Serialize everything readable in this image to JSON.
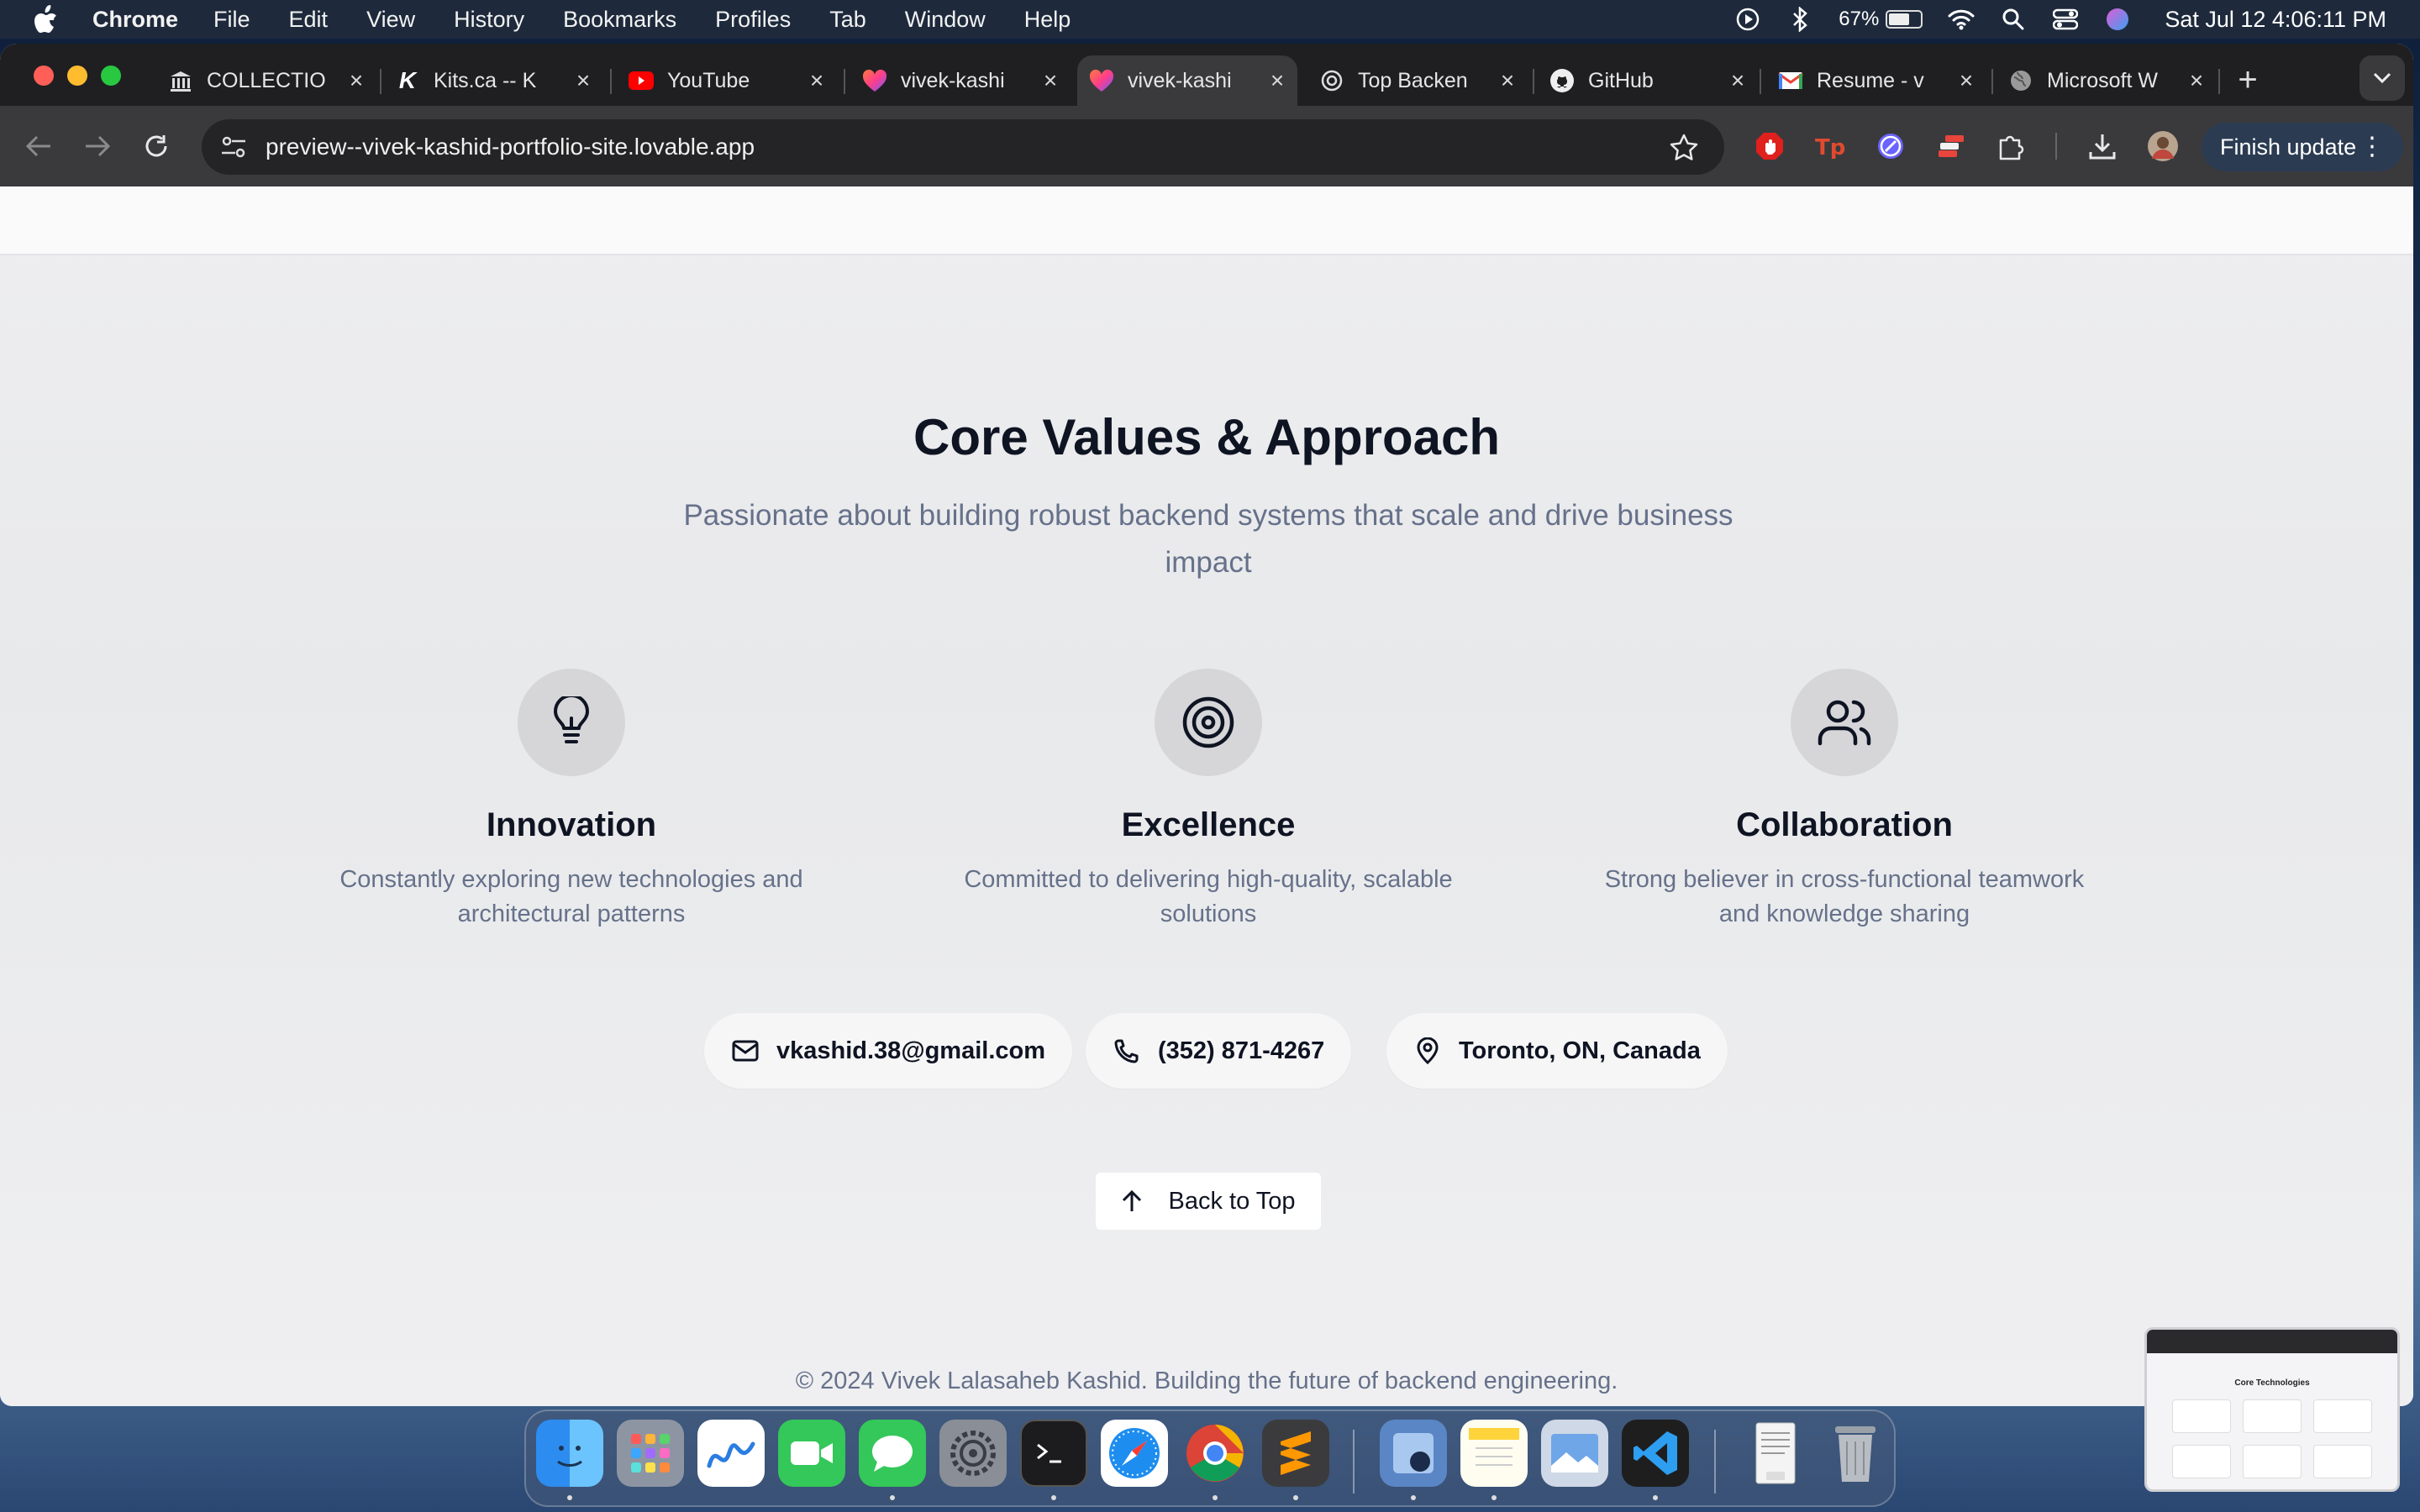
{
  "menubar": {
    "app_name": "Chrome",
    "items": [
      "File",
      "Edit",
      "View",
      "History",
      "Bookmarks",
      "Profiles",
      "Tab",
      "Window",
      "Help"
    ],
    "battery_percent": "67%",
    "battery_level": 0.67,
    "clock": "Sat Jul 12  4:06:11 PM"
  },
  "tabs": [
    {
      "title": "COLLECTIO",
      "icon": "museum-icon"
    },
    {
      "title": "Kits.ca -- K",
      "icon": "kits-logo-icon"
    },
    {
      "title": "YouTube",
      "icon": "youtube-icon"
    },
    {
      "title": "vivek-kashi",
      "icon": "lovable-heart-icon"
    },
    {
      "title": "vivek-kashi",
      "icon": "lovable-heart-icon",
      "active": true
    },
    {
      "title": "Top Backen",
      "icon": "openai-icon"
    },
    {
      "title": "GitHub",
      "icon": "github-icon"
    },
    {
      "title": "Resume - v",
      "icon": "gmail-icon"
    },
    {
      "title": "Microsoft W",
      "icon": "globe-icon"
    }
  ],
  "toolbar": {
    "url": "preview--vivek-kashid-portfolio-site.lovable.app",
    "finish_update": "Finish update"
  },
  "page": {
    "title": "Core Values & Approach",
    "subtitle": "Passionate about building robust backend systems that scale and drive business impact",
    "values": [
      {
        "title": "Innovation",
        "description": "Constantly exploring new technologies and architectural patterns",
        "icon": "lightbulb-icon"
      },
      {
        "title": "Excellence",
        "description": "Committed to delivering high-quality, scalable solutions",
        "icon": "target-icon"
      },
      {
        "title": "Collaboration",
        "description": "Strong believer in cross-functional teamwork and knowledge sharing",
        "icon": "users-icon"
      }
    ],
    "contacts": {
      "email": "vkashid.38@gmail.com",
      "phone": "(352) 871-4267",
      "location": "Toronto, ON, Canada"
    },
    "back_to_top": "Back to Top",
    "footer": "© 2024 Vivek Lalasaheb Kashid. Building the future of backend engineering."
  },
  "thumbnail": {
    "title": "Core Technologies"
  },
  "dock": {
    "apps": [
      "Finder",
      "Launchpad",
      "Freeform",
      "FaceTime",
      "Messages",
      "System Settings",
      "Terminal",
      "Safari",
      "Chrome",
      "Sublime Text",
      "Preview",
      "Notes",
      "Preview Viewer",
      "Visual Studio Code",
      "Documents",
      "Trash"
    ]
  },
  "colors": {
    "accent_text": "#0f1423",
    "muted_text": "#66718a",
    "icon_bg": "#d6d6d9",
    "chrome_dark": "#1f1f22",
    "chrome_toolbar": "#3a3a3d"
  }
}
